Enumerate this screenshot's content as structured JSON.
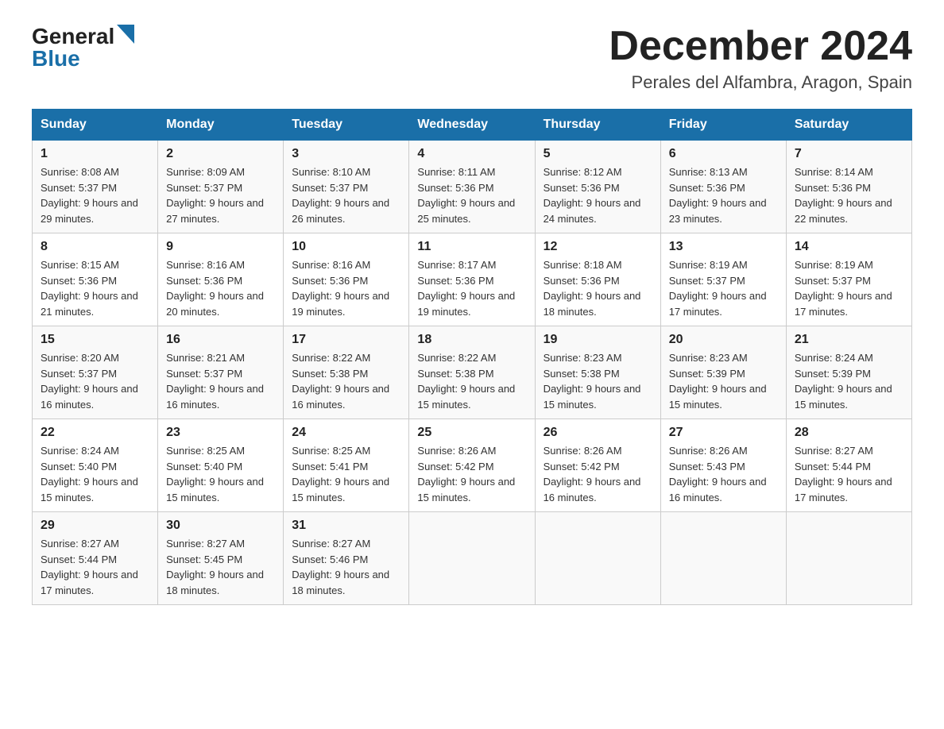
{
  "header": {
    "title": "December 2024",
    "subtitle": "Perales del Alfambra, Aragon, Spain",
    "logo_general": "General",
    "logo_blue": "Blue"
  },
  "weekdays": [
    "Sunday",
    "Monday",
    "Tuesday",
    "Wednesday",
    "Thursday",
    "Friday",
    "Saturday"
  ],
  "weeks": [
    [
      {
        "day": "1",
        "sunrise": "8:08 AM",
        "sunset": "5:37 PM",
        "daylight": "9 hours and 29 minutes."
      },
      {
        "day": "2",
        "sunrise": "8:09 AM",
        "sunset": "5:37 PM",
        "daylight": "9 hours and 27 minutes."
      },
      {
        "day": "3",
        "sunrise": "8:10 AM",
        "sunset": "5:37 PM",
        "daylight": "9 hours and 26 minutes."
      },
      {
        "day": "4",
        "sunrise": "8:11 AM",
        "sunset": "5:36 PM",
        "daylight": "9 hours and 25 minutes."
      },
      {
        "day": "5",
        "sunrise": "8:12 AM",
        "sunset": "5:36 PM",
        "daylight": "9 hours and 24 minutes."
      },
      {
        "day": "6",
        "sunrise": "8:13 AM",
        "sunset": "5:36 PM",
        "daylight": "9 hours and 23 minutes."
      },
      {
        "day": "7",
        "sunrise": "8:14 AM",
        "sunset": "5:36 PM",
        "daylight": "9 hours and 22 minutes."
      }
    ],
    [
      {
        "day": "8",
        "sunrise": "8:15 AM",
        "sunset": "5:36 PM",
        "daylight": "9 hours and 21 minutes."
      },
      {
        "day": "9",
        "sunrise": "8:16 AM",
        "sunset": "5:36 PM",
        "daylight": "9 hours and 20 minutes."
      },
      {
        "day": "10",
        "sunrise": "8:16 AM",
        "sunset": "5:36 PM",
        "daylight": "9 hours and 19 minutes."
      },
      {
        "day": "11",
        "sunrise": "8:17 AM",
        "sunset": "5:36 PM",
        "daylight": "9 hours and 19 minutes."
      },
      {
        "day": "12",
        "sunrise": "8:18 AM",
        "sunset": "5:36 PM",
        "daylight": "9 hours and 18 minutes."
      },
      {
        "day": "13",
        "sunrise": "8:19 AM",
        "sunset": "5:37 PM",
        "daylight": "9 hours and 17 minutes."
      },
      {
        "day": "14",
        "sunrise": "8:19 AM",
        "sunset": "5:37 PM",
        "daylight": "9 hours and 17 minutes."
      }
    ],
    [
      {
        "day": "15",
        "sunrise": "8:20 AM",
        "sunset": "5:37 PM",
        "daylight": "9 hours and 16 minutes."
      },
      {
        "day": "16",
        "sunrise": "8:21 AM",
        "sunset": "5:37 PM",
        "daylight": "9 hours and 16 minutes."
      },
      {
        "day": "17",
        "sunrise": "8:22 AM",
        "sunset": "5:38 PM",
        "daylight": "9 hours and 16 minutes."
      },
      {
        "day": "18",
        "sunrise": "8:22 AM",
        "sunset": "5:38 PM",
        "daylight": "9 hours and 15 minutes."
      },
      {
        "day": "19",
        "sunrise": "8:23 AM",
        "sunset": "5:38 PM",
        "daylight": "9 hours and 15 minutes."
      },
      {
        "day": "20",
        "sunrise": "8:23 AM",
        "sunset": "5:39 PM",
        "daylight": "9 hours and 15 minutes."
      },
      {
        "day": "21",
        "sunrise": "8:24 AM",
        "sunset": "5:39 PM",
        "daylight": "9 hours and 15 minutes."
      }
    ],
    [
      {
        "day": "22",
        "sunrise": "8:24 AM",
        "sunset": "5:40 PM",
        "daylight": "9 hours and 15 minutes."
      },
      {
        "day": "23",
        "sunrise": "8:25 AM",
        "sunset": "5:40 PM",
        "daylight": "9 hours and 15 minutes."
      },
      {
        "day": "24",
        "sunrise": "8:25 AM",
        "sunset": "5:41 PM",
        "daylight": "9 hours and 15 minutes."
      },
      {
        "day": "25",
        "sunrise": "8:26 AM",
        "sunset": "5:42 PM",
        "daylight": "9 hours and 15 minutes."
      },
      {
        "day": "26",
        "sunrise": "8:26 AM",
        "sunset": "5:42 PM",
        "daylight": "9 hours and 16 minutes."
      },
      {
        "day": "27",
        "sunrise": "8:26 AM",
        "sunset": "5:43 PM",
        "daylight": "9 hours and 16 minutes."
      },
      {
        "day": "28",
        "sunrise": "8:27 AM",
        "sunset": "5:44 PM",
        "daylight": "9 hours and 17 minutes."
      }
    ],
    [
      {
        "day": "29",
        "sunrise": "8:27 AM",
        "sunset": "5:44 PM",
        "daylight": "9 hours and 17 minutes."
      },
      {
        "day": "30",
        "sunrise": "8:27 AM",
        "sunset": "5:45 PM",
        "daylight": "9 hours and 18 minutes."
      },
      {
        "day": "31",
        "sunrise": "8:27 AM",
        "sunset": "5:46 PM",
        "daylight": "9 hours and 18 minutes."
      },
      null,
      null,
      null,
      null
    ]
  ]
}
